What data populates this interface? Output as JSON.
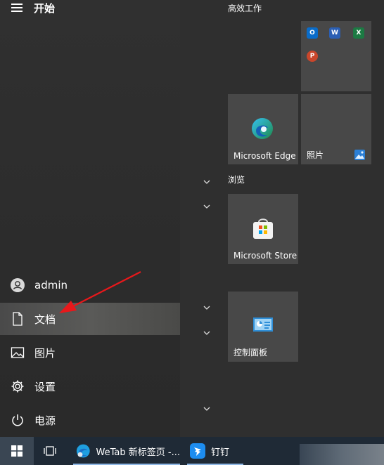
{
  "header": {
    "title": "开始"
  },
  "nav": {
    "user": "admin",
    "documents": "文档",
    "pictures": "图片",
    "settings": "设置",
    "power": "电源"
  },
  "groups": {
    "productivity": "高效工作",
    "browse": "浏览"
  },
  "tiles": {
    "office": {
      "apps": [
        "outlook-icon",
        "word-icon",
        "excel-icon",
        "powerpoint-icon"
      ]
    },
    "edge": {
      "label": "Microsoft Edge"
    },
    "photos": {
      "label": "照片"
    },
    "store": {
      "label": "Microsoft Store"
    },
    "control_panel": {
      "label": "控制面板"
    }
  },
  "taskbar": {
    "wetab": "WeTab 新标签页 -...",
    "dingtalk": "钉钉"
  },
  "colors": {
    "highlight": "#505050",
    "tile_bg": "#484848",
    "taskbar_bg": "#1f2a36",
    "arrow": "#e8181b",
    "active_underline": "#8fb8e6"
  }
}
